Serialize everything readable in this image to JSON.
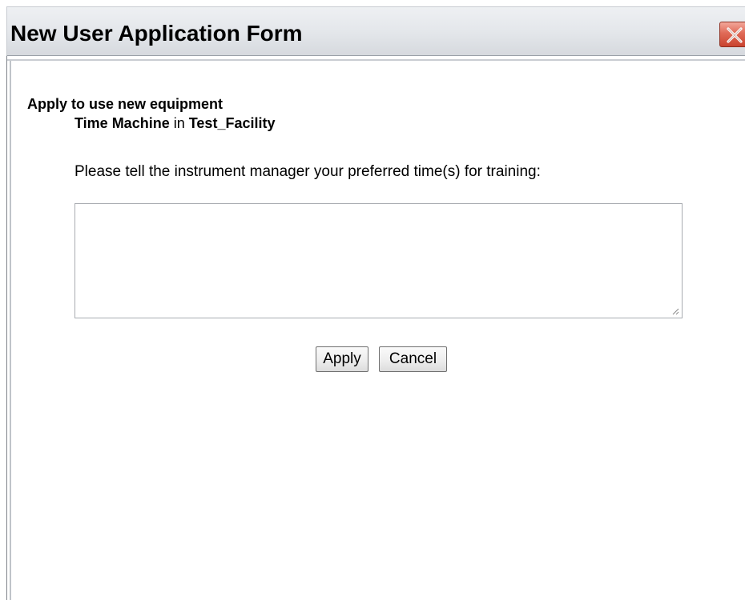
{
  "window": {
    "title": "New User Application Form",
    "close_icon": "close-icon"
  },
  "form": {
    "heading": "Apply to use new equipment",
    "equipment_name": "Time Machine",
    "in_label": "in",
    "facility_name": "Test_Facility",
    "prompt": "Please tell the instrument manager your preferred time(s) for training:",
    "training_time_value": "",
    "apply_label": "Apply",
    "cancel_label": "Cancel"
  },
  "colors": {
    "close_button": "#e06a57",
    "titlebar": "#e3e6ea"
  }
}
